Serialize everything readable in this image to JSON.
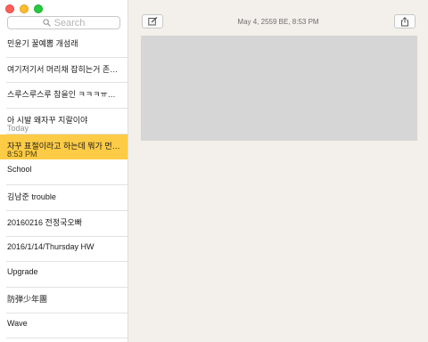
{
  "search": {
    "placeholder": "Search"
  },
  "notes": [
    {
      "title": "민윤기 꿀예뽐 개섬래",
      "sub": ""
    },
    {
      "title": "여기저기서 머리채 잡히는거 존나...",
      "sub": ""
    },
    {
      "title": "스루스루스루 참을인 ㅋㅋㅋㅠㅠㅠ~~~",
      "sub": ""
    },
    {
      "title": "아 시발 왜자꾸 지랄이야",
      "sub": "Today"
    },
    {
      "title": "자꾸 표절이라고 하는데 뭐가 먼저...",
      "sub": "8:53 PM",
      "selected": true
    },
    {
      "title": "School",
      "sub": ""
    },
    {
      "title": "김남준 trouble",
      "sub": ""
    },
    {
      "title": "20160216 전정국오빠",
      "sub": ""
    },
    {
      "title": "2016/1/14/Thursday HW",
      "sub": ""
    },
    {
      "title": "Upgrade",
      "sub": ""
    },
    {
      "title": "防弾少年團",
      "sub": ""
    },
    {
      "title": "Wave",
      "sub": ""
    }
  ],
  "main": {
    "date": "May 4, 2559 BE, 8:53 PM"
  },
  "icons": {
    "compose": "compose-icon",
    "share": "share-icon",
    "search": "search-icon"
  },
  "colors": {
    "selection": "#fdcb45",
    "attachment_placeholder": "#d6d6d6"
  }
}
